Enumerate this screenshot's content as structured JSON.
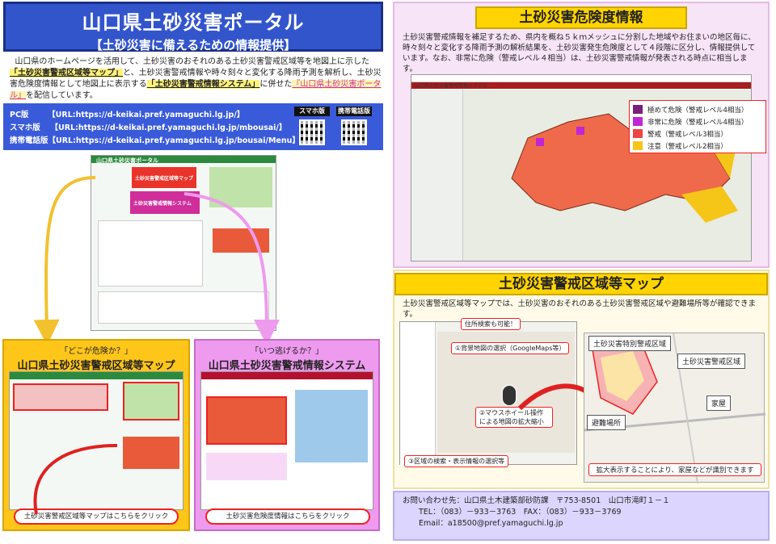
{
  "header": {
    "title": "山口県土砂災害ポータル",
    "subtitle": "【土砂災害に備えるための情報提供】"
  },
  "intro": {
    "part1": "山口県のホームページを活用して、土砂災害のおそれのある土砂災害警戒区域等を地図上に示した",
    "link1": "「土砂災害警戒区域等マップ」",
    "part2": "と、土砂災害警戒情報や時々刻々と変化する降雨予測を解析し、土砂災害危険度情報として地図上に表示する",
    "link2": "「土砂災害警戒情報システム」",
    "part3": "に併せた",
    "link3": "『山口県土砂災害ポータル』",
    "part4": "を配信しています。"
  },
  "urls": {
    "pc": "PC版　　　【URL:https://d-keikai.pref.yamaguchi.lg.jp/】",
    "smartphone": "スマホ版　 【URL:https://d-keikai.pref.yamaguchi.lg.jp/mbousai/】",
    "mobile": "携帯電話版【URL:https://d-keikai.pref.yamaguchi.lg.jp/bousai/Menu】",
    "qr_label_smartphone": "スマホ版",
    "qr_label_mobile": "携帯電話版"
  },
  "portal_shot": {
    "title": "山口県土砂災害ポータル",
    "banner1": "土砂災害警戒区域等マップ",
    "banner2": "土砂災害警戒情報システム"
  },
  "yellow_box": {
    "sub": "「どこが危険か？」",
    "title": "山口県土砂災害警戒区域等マップ",
    "button": "土砂災害警戒区域等マップはこちらをクリック"
  },
  "pink_box": {
    "sub": "「いつ逃げるか？」",
    "title": "山口県土砂災害警戒情報システム",
    "button": "土砂災害危険度情報はこちらをクリック"
  },
  "risk": {
    "title": "土砂災害危険度情報",
    "text": "土砂災害警戒情報を補足するため、県内を概ね５ｋｍメッシュに分割した地域やお住まいの地区毎に、時々刻々と変化する降雨予測の解析結果を、土砂災害発生危険度として４段階に区分し、情報提供しています。なお、非常に危険（警戒レベル４相当）は、土砂災害警戒情報が発表される時点に相当します。",
    "shot_title": "山口県土砂災害警戒情報システム",
    "legend": [
      {
        "label": "極めて危険（警戒レベル4相当）",
        "color": "#7a1f7a"
      },
      {
        "label": "非常に危険（警戒レベル4相当）",
        "color": "#c026d3"
      },
      {
        "label": "警戒（警戒レベル3相当）",
        "color": "#ef4444"
      },
      {
        "label": "注意（警戒レベル2相当）",
        "color": "#f5c518"
      }
    ]
  },
  "zonemap": {
    "title": "土砂災害警戒区域等マップ",
    "text": "土砂災害警戒区域等マップでは、土砂災害のおそれのある土砂災害警戒区域や避難場所等が確認できます。",
    "callout_search": "住所検索も可能！",
    "callout1": "①背景地図の選択（GoogleMaps等）",
    "callout2": "②マウスホイール操作による地図の拡大縮小",
    "callout3": "③区域の検索・表示情報の選択等",
    "tag_special": "土砂災害特別警戒区域",
    "tag_zone": "土砂災害警戒区域",
    "tag_house": "家屋",
    "tag_shelter": "避難場所",
    "zoom_note": "拡大表示することにより、家屋などが識別できます"
  },
  "contact": {
    "line1": "お問い合わせ先：山口県土木建築部砂防課　〒753-8501　山口市滝町１－１",
    "line2": "TEL：（083）－933－3763　FAX：（083）－933－3769",
    "line3": "Email：a18500@pref.yamaguchi.lg.jp"
  }
}
